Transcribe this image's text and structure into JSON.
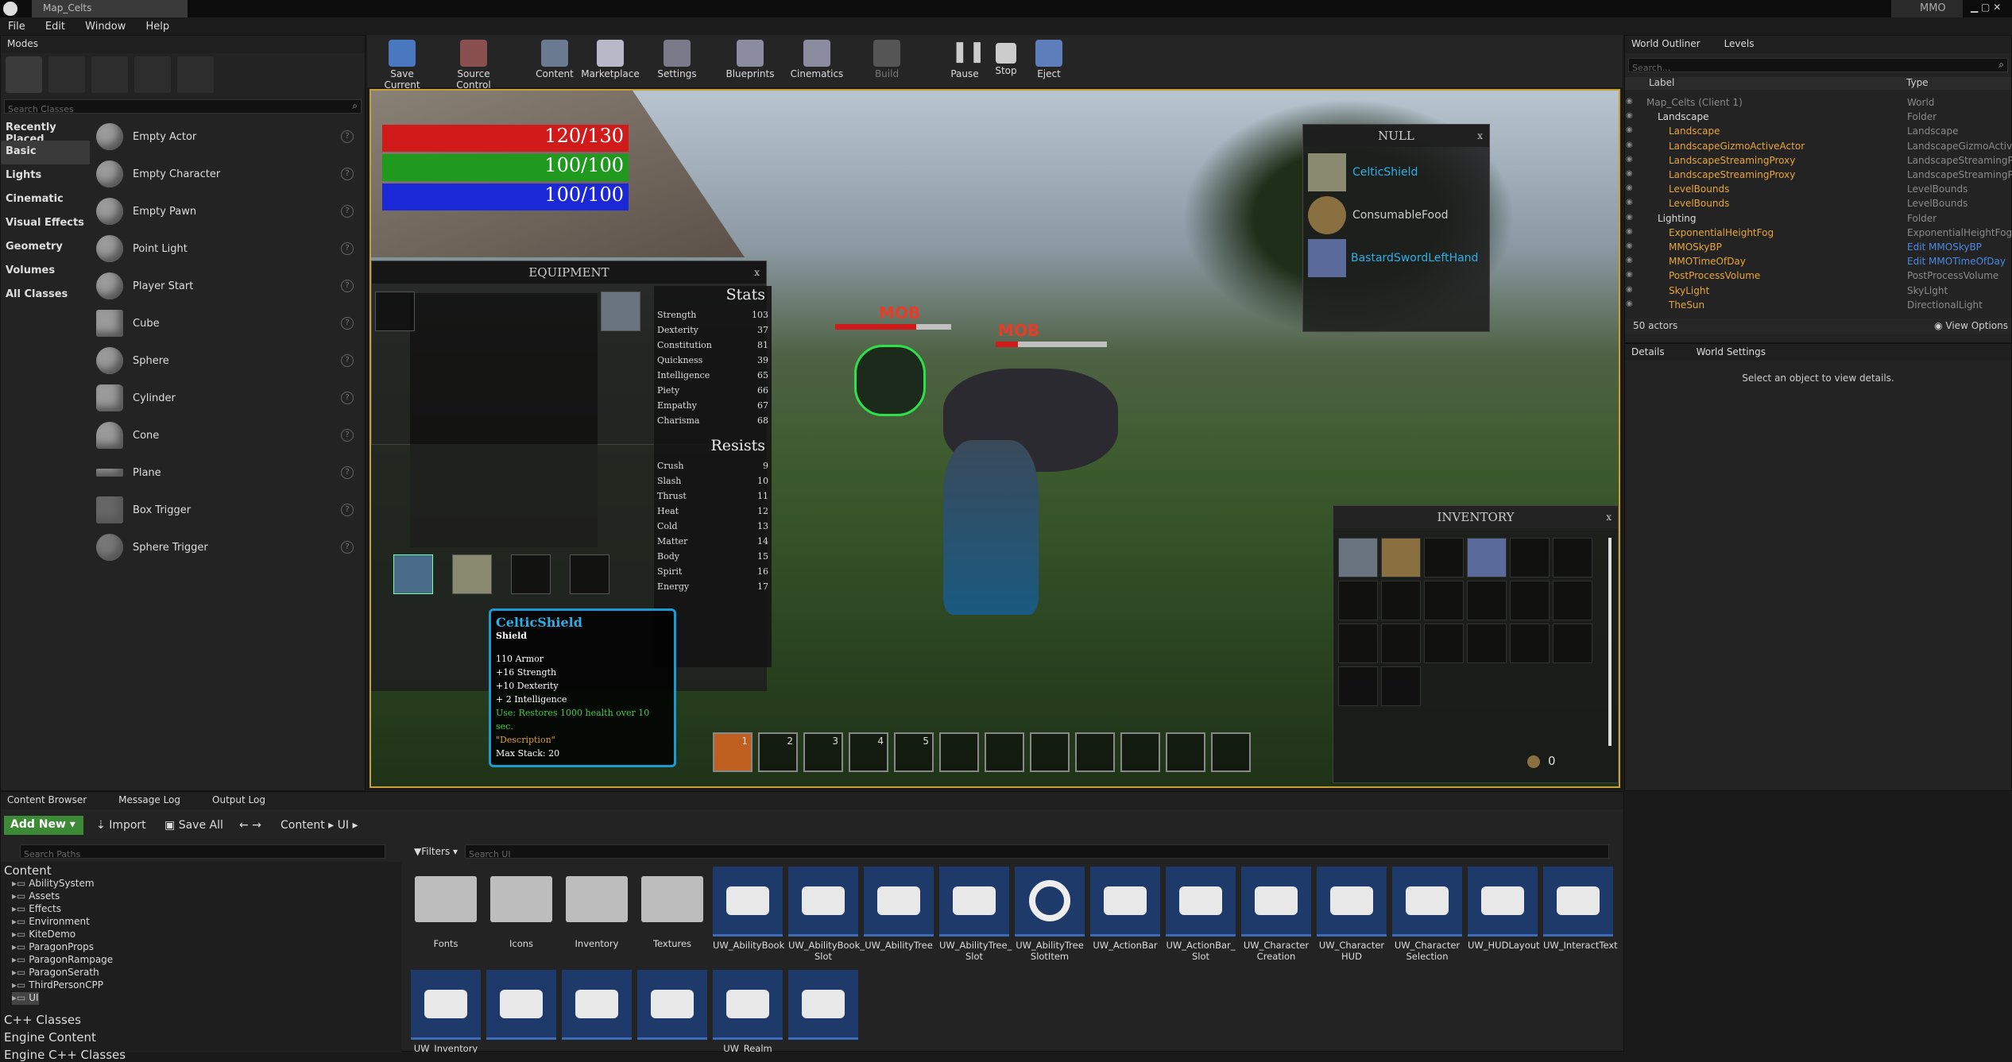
{
  "window": {
    "title": "Map_Celts",
    "project": "MMO"
  },
  "menu": [
    "File",
    "Edit",
    "Window",
    "Help"
  ],
  "modes": {
    "tab": "Modes",
    "search_placeholder": "Search Classes",
    "categories": [
      "Recently Placed",
      "Basic",
      "Lights",
      "Cinematic",
      "Visual Effects",
      "Geometry",
      "Volumes",
      "All Classes"
    ],
    "classes": [
      "Empty Actor",
      "Empty Character",
      "Empty Pawn",
      "Point Light",
      "Player Start",
      "Cube",
      "Sphere",
      "Cylinder",
      "Cone",
      "Plane",
      "Box Trigger",
      "Sphere Trigger"
    ]
  },
  "toolbar": [
    "Save Current",
    "Source Control",
    "Content",
    "Marketplace",
    "Settings",
    "Blueprints",
    "Cinematics",
    "Build",
    "Pause",
    "Stop",
    "Eject"
  ],
  "hud": {
    "health": "120/130",
    "stamina": "100/100",
    "mana": "100/100",
    "health_color": "#d11a1a",
    "stamina_color": "#1f9a1f",
    "mana_color": "#1a28d8"
  },
  "equipment": {
    "title": "EQUIPMENT",
    "close": "x",
    "stats_title": "Stats",
    "stats": [
      [
        "Strength",
        "103"
      ],
      [
        "Dexterity",
        "37"
      ],
      [
        "Constitution",
        "81"
      ],
      [
        "Quickness",
        "39"
      ],
      [
        "Intelligence",
        "65"
      ],
      [
        "Piety",
        "66"
      ],
      [
        "Empathy",
        "67"
      ],
      [
        "Charisma",
        "68"
      ]
    ],
    "resists_title": "Resists",
    "resists": [
      [
        "Crush",
        "9"
      ],
      [
        "Slash",
        "10"
      ],
      [
        "Thrust",
        "11"
      ],
      [
        "Heat",
        "12"
      ],
      [
        "Cold",
        "13"
      ],
      [
        "Matter",
        "14"
      ],
      [
        "Body",
        "15"
      ],
      [
        "Spirit",
        "16"
      ],
      [
        "Energy",
        "17"
      ]
    ]
  },
  "tooltip": {
    "name": "CelticShield",
    "type": "Shield",
    "l1": "110 Armor",
    "l2": "+16 Strength",
    "l3": "+10 Dexterity",
    "l4": "+ 2 Intelligence",
    "use": "Use: Restores 1000 health over 10 sec.",
    "desc": "\"Description\"",
    "stack": "Max Stack: 20"
  },
  "mobs": [
    "MOB",
    "MOB"
  ],
  "null_window": {
    "title": "NULL",
    "close": "x",
    "items": [
      "CelticShield",
      "ConsumableFood",
      "BastardSwordLeftHand"
    ]
  },
  "inventory": {
    "title": "INVENTORY",
    "close": "x",
    "gold": "0"
  },
  "actionbar": [
    "1",
    "2",
    "3",
    "4",
    "5"
  ],
  "outliner": {
    "tab1": "World Outliner",
    "tab2": "Levels",
    "search_placeholder": "Search...",
    "col_label": "Label",
    "col_type": "Type",
    "rows": [
      [
        "Map_Celts (Client 1)",
        "World"
      ],
      [
        "Landscape",
        "Folder"
      ],
      [
        "Landscape",
        "Landscape"
      ],
      [
        "LandscapeGizmoActiveActor",
        "LandscapeGizmoActiveA"
      ],
      [
        "LandscapeStreamingProxy",
        "LandscapeStreamingPro"
      ],
      [
        "LandscapeStreamingProxy",
        "LandscapeStreamingPro"
      ],
      [
        "LevelBounds",
        "LevelBounds"
      ],
      [
        "LevelBounds",
        "LevelBounds"
      ],
      [
        "Lighting",
        "Folder"
      ],
      [
        "ExponentialHeightFog",
        "ExponentialHeightFog"
      ],
      [
        "MMOSkyBP",
        "Edit MMOSkyBP"
      ],
      [
        "MMOTimeOfDay",
        "Edit MMOTimeOfDay"
      ],
      [
        "PostProcessVolume",
        "PostProcessVolume"
      ],
      [
        "SkyLight",
        "SkyLight"
      ],
      [
        "TheSun",
        "DirectionalLight"
      ]
    ],
    "actors": "50 actors",
    "view_options": "View Options"
  },
  "details": {
    "tab1": "Details",
    "tab2": "World Settings",
    "empty": "Select an object to view details."
  },
  "bottom": {
    "tabs": [
      "Content Browser",
      "Message Log",
      "Output Log"
    ],
    "add_new": "Add New",
    "import": "Import",
    "save_all": "Save All",
    "path": [
      "Content",
      "UI"
    ],
    "search_paths": "Search Paths",
    "filters": "Filters",
    "search_ui": "Search UI",
    "tree_root": "Content",
    "tree": [
      "AbilitySystem",
      "Assets",
      "Effects",
      "Environment",
      "KiteDemo",
      "ParagonProps",
      "ParagonRampage",
      "ParagonSerath",
      "ThirdPersonCPP",
      "UI"
    ],
    "tree_more": [
      "C++ Classes",
      "Engine Content",
      "Engine C++ Classes"
    ],
    "folders": [
      "Fonts",
      "Icons",
      "Inventory",
      "Textures"
    ],
    "assets": [
      "UW_AbilityBook",
      "UW_AbilityBook_\nSlot",
      "UW_AbilityTree",
      "UW_AbilityTree_\nSlot",
      "UW_AbilityTree\nSlotItem",
      "UW_ActionBar",
      "UW_ActionBar_\nSlot",
      "UW_Character\nCreation",
      "UW_Character\nHUD",
      "UW_Character\nSelection",
      "UW_HUDLayout",
      "UW_InteractText"
    ],
    "assets2": [
      "UW_Inventory",
      "",
      "",
      "",
      "UW_Realm",
      ""
    ]
  }
}
